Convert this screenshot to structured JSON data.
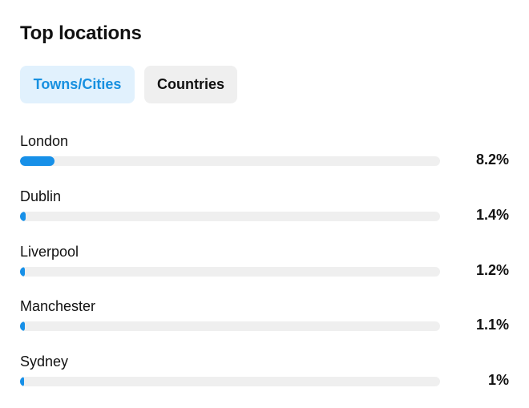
{
  "header": {
    "title": "Top locations"
  },
  "tabs": [
    {
      "label": "Towns/Cities",
      "active": true
    },
    {
      "label": "Countries",
      "active": false
    }
  ],
  "colors": {
    "accent": "#1790e8",
    "active_tab_bg": "#e1f1fd",
    "inactive_tab_bg": "#efefef",
    "track": "#efefef"
  },
  "locations": [
    {
      "name": "London",
      "percent_label": "8.2%",
      "percent": 8.2
    },
    {
      "name": "Dublin",
      "percent_label": "1.4%",
      "percent": 1.4
    },
    {
      "name": "Liverpool",
      "percent_label": "1.2%",
      "percent": 1.2
    },
    {
      "name": "Manchester",
      "percent_label": "1.1%",
      "percent": 1.1
    },
    {
      "name": "Sydney",
      "percent_label": "1%",
      "percent": 1.0
    }
  ],
  "bar_scale_max_percent": 100
}
